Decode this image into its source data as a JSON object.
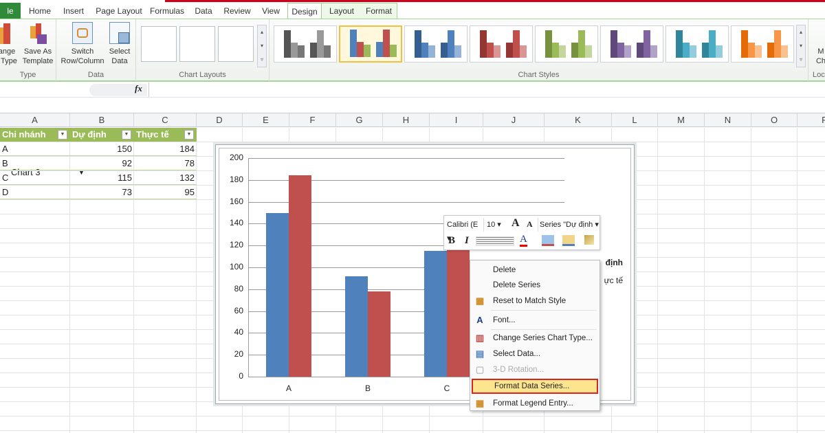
{
  "ribbon": {
    "tabs": [
      "le",
      "Home",
      "Insert",
      "Page Layout",
      "Formulas",
      "Data",
      "Review",
      "View",
      "Design",
      "Layout",
      "Format"
    ],
    "active_tab": "Design",
    "groups": {
      "type": {
        "label": "Type",
        "buttons": [
          {
            "line1": "ange",
            "line2": "t Type"
          },
          {
            "line1": "Save As",
            "line2": "Template"
          }
        ]
      },
      "data": {
        "label": "Data",
        "buttons": [
          {
            "line1": "Switch",
            "line2": "Row/Column"
          },
          {
            "line1": "Select",
            "line2": "Data"
          }
        ]
      },
      "layouts": {
        "label": "Chart Layouts"
      },
      "styles": {
        "label": "Chart Styles",
        "colors": [
          [
            "#555555",
            "#999999",
            "#777777"
          ],
          [
            "#4f81bd",
            "#c0504d",
            "#9bbb59"
          ],
          [
            "#365f91",
            "#4f81bd",
            "#95b3d7"
          ],
          [
            "#943634",
            "#c0504d",
            "#d99694"
          ],
          [
            "#76923c",
            "#9bbb59",
            "#c3d69b"
          ],
          [
            "#5f497a",
            "#8064a2",
            "#b2a2c7"
          ],
          [
            "#31859b",
            "#4bacc6",
            "#93cddd"
          ],
          [
            "#e36c09",
            "#f79646",
            "#fac08f"
          ]
        ],
        "selected": 1
      },
      "location": {
        "label": "Loc",
        "btn1": "M",
        "btn2": "Ch"
      }
    }
  },
  "formula_bar": {
    "name_box": "Chart 3",
    "fx": "fx",
    "value": ""
  },
  "columns": [
    "A",
    "B",
    "C",
    "D",
    "E",
    "F",
    "G",
    "H",
    "I",
    "J",
    "K",
    "L",
    "M",
    "N",
    "O",
    "P"
  ],
  "table": {
    "headers": [
      "Chi nhánh",
      "Dự định",
      "Thực tế"
    ],
    "rows": [
      [
        "A",
        "150",
        "184"
      ],
      [
        "B",
        "92",
        "78"
      ],
      [
        "C",
        "115",
        "132"
      ],
      [
        "D",
        "73",
        "95"
      ]
    ]
  },
  "chart_data": {
    "type": "bar",
    "categories": [
      "A",
      "B",
      "C",
      "D"
    ],
    "series": [
      {
        "name": "Dự định",
        "values": [
          150,
          92,
          115,
          73
        ],
        "color": "#4f81bd"
      },
      {
        "name": "Thực tế",
        "values": [
          184,
          78,
          132,
          95
        ],
        "color": "#c0504d"
      }
    ],
    "ylim": [
      0,
      200
    ],
    "yticks": [
      "0",
      "20",
      "40",
      "60",
      "80",
      "100",
      "120",
      "140",
      "160",
      "180",
      "200"
    ],
    "legend": "right",
    "legend_visible": [
      "định",
      "ực tế"
    ]
  },
  "mini_toolbar": {
    "font": "Calibri (E",
    "size": "10",
    "series": "Series \"Dự định",
    "bold": "B",
    "italic": "I",
    "grow": "A",
    "shrink": "A",
    "font_color": "A"
  },
  "context_menu": [
    {
      "label": "Delete",
      "icon": "",
      "enabled": true
    },
    {
      "label": "Delete Series",
      "icon": "",
      "enabled": true
    },
    {
      "label": "Reset to Match Style",
      "icon": "reset-style",
      "enabled": true
    },
    {
      "label": "Font...",
      "icon": "A",
      "enabled": true
    },
    {
      "label": "Change Series Chart Type...",
      "icon": "chart-type",
      "enabled": true
    },
    {
      "label": "Select Data...",
      "icon": "select-data",
      "enabled": true
    },
    {
      "label": "3-D Rotation...",
      "icon": "3d",
      "enabled": false
    },
    {
      "label": "Format Data Series...",
      "icon": "",
      "enabled": true,
      "highlighted": true
    },
    {
      "label": "Format Legend Entry...",
      "icon": "format-legend",
      "enabled": true
    }
  ]
}
